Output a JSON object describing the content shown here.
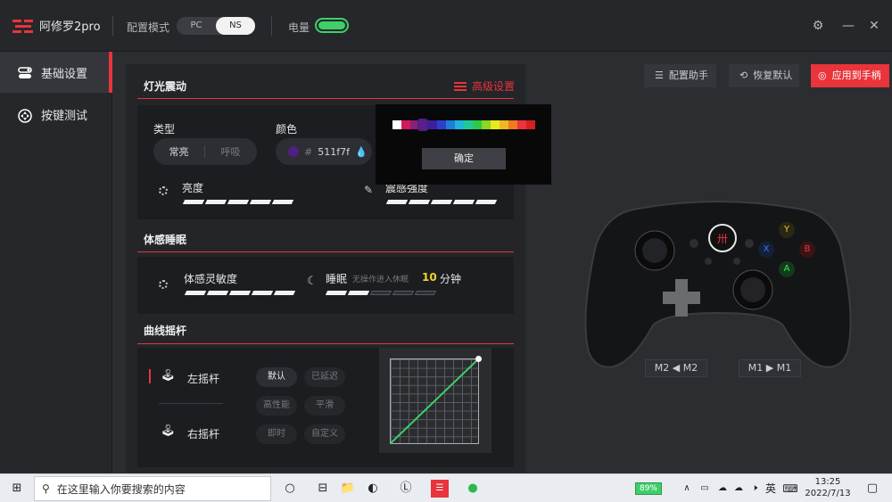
{
  "app": {
    "title": "阿修罗2pro"
  },
  "header": {
    "mode_label": "配置模式",
    "modes": [
      "PC",
      "NS"
    ],
    "battery_label": "电量"
  },
  "sidebar": {
    "items": [
      {
        "label": "基础设置"
      },
      {
        "label": "按键测试"
      }
    ]
  },
  "light": {
    "title": "灯光震动",
    "advanced": "高级设置",
    "type_label": "类型",
    "type_options": [
      "常亮",
      "呼吸"
    ],
    "color_label": "颜色",
    "color_hash": "#",
    "color_value": "511f7f",
    "color_swatch": "#511f7f",
    "brightness_label": "亮度",
    "brightness_level": 5,
    "vibration_label": "震感强度",
    "vibration_level": 5
  },
  "color_popup": {
    "confirm": "确定"
  },
  "sleep": {
    "title": "体感睡眠",
    "sensitivity_label": "体感灵敏度",
    "sensitivity_level": 5,
    "sleep_label": "睡眠",
    "sleep_hint": "无操作进入休眠",
    "sleep_minutes": "10",
    "sleep_unit": "分钟",
    "sleep_level": 2
  },
  "curve": {
    "title": "曲线摇杆",
    "left_stick": "左摇杆",
    "right_stick": "右摇杆",
    "presets": [
      "默认",
      "已延迟",
      "高性能",
      "平滑",
      "即时",
      "自定义"
    ]
  },
  "actions": {
    "helper": "配置助手",
    "restore": "恢复默认",
    "apply": "应用到手柄"
  },
  "mapping": {
    "m2": "M2 ◀ M2",
    "m1": "M1 ▶ M1"
  },
  "controller_buttons": {
    "y": "Y",
    "x": "X",
    "b": "B",
    "a": "A"
  },
  "taskbar": {
    "search_placeholder": "在这里输入你要搜索的内容",
    "battery": "89%",
    "ime": "英",
    "time": "13:25",
    "date": "2022/7/13"
  },
  "colors": {
    "accent": "#e8343a",
    "battery": "#3ecf6a"
  }
}
